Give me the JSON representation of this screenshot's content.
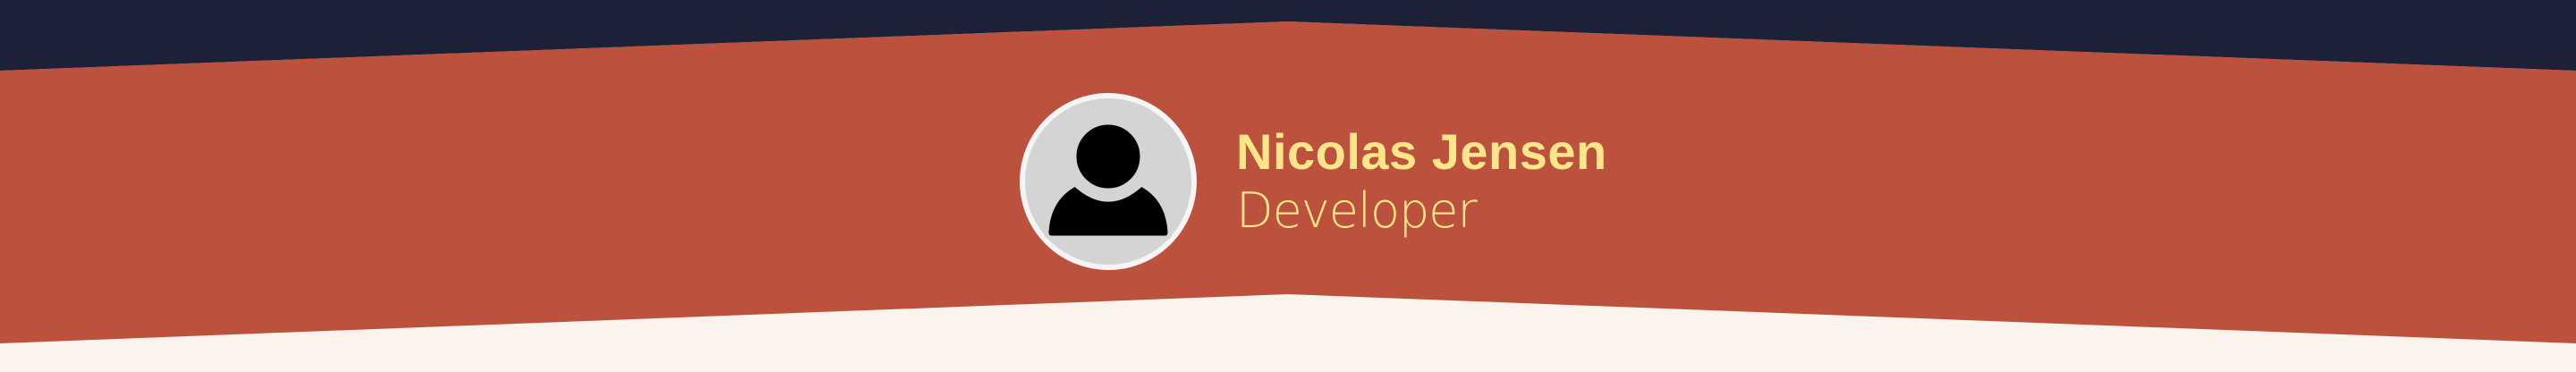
{
  "profile": {
    "name": "Nicolas Jensen",
    "role": "Developer"
  },
  "avatar": {
    "icon": "user-silhouette-icon"
  },
  "colors": {
    "top_band": "#1c2138",
    "main_band": "#bc523d",
    "bottom_band": "#fdf3ed",
    "name_text": "#fde68a",
    "role_text": "#fde68a",
    "avatar_fill": "#d4d4d4",
    "avatar_ring": "#f5f5f5",
    "avatar_figure": "#000000"
  }
}
